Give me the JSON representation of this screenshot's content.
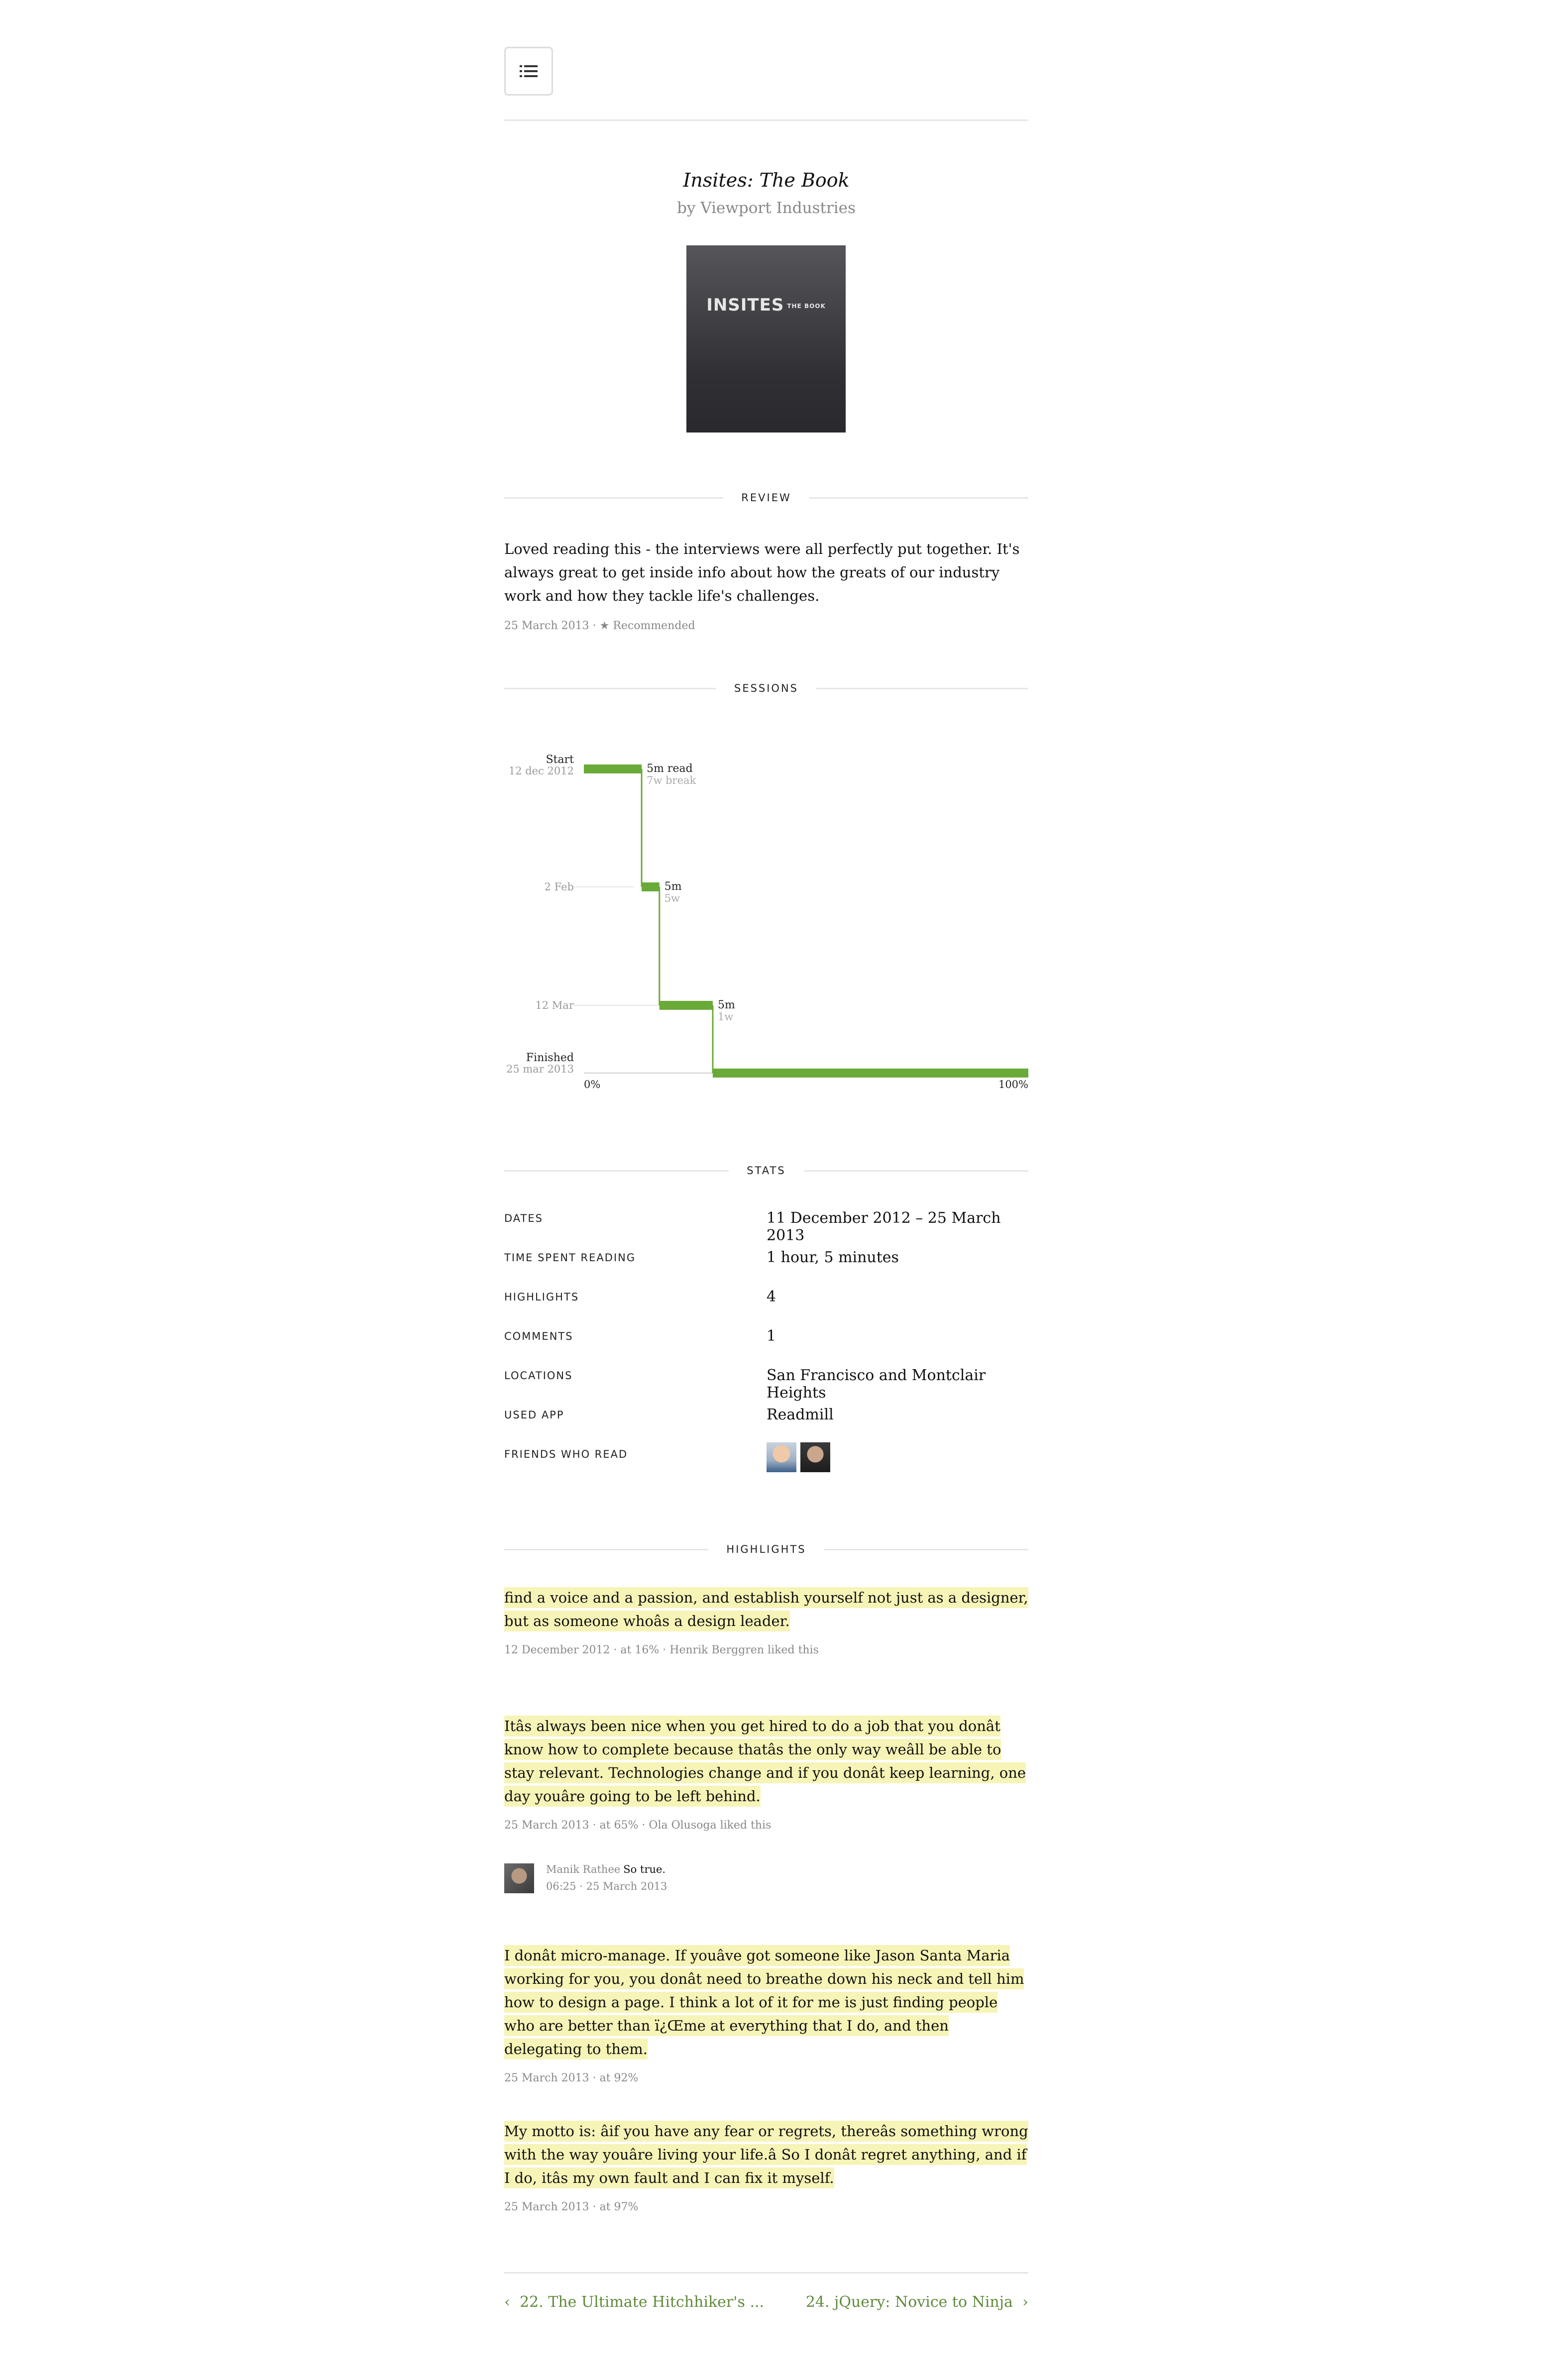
{
  "header": {
    "menu_icon": "list-icon"
  },
  "book": {
    "title": "Insites: The Book",
    "author": "by Viewport Industries",
    "cover_text": "INSITES",
    "cover_sub": "THE BOOK"
  },
  "review": {
    "heading": "REVIEW",
    "text": "Loved reading this - the interviews were all perfectly put together. It's always great to get inside info about how the greats of our industry work and how they tackle life's challenges.",
    "meta": "25 March 2013 · ★ Recommended"
  },
  "sessions": {
    "heading": "SESSIONS",
    "labels": {
      "start_title": "Start",
      "start_date": "12 dec 2012",
      "feb": "2 Feb",
      "mar": "12 Mar",
      "finished_title": "Finished",
      "finished_date": "25 mar 2013",
      "x_min": "0%",
      "x_max": "100%"
    },
    "accent_color": "#6aaa38"
  },
  "chart_data": {
    "type": "bar",
    "title": "",
    "xlabel": "",
    "ylabel": "",
    "x_range": [
      "0%",
      "100%"
    ],
    "sessions": [
      {
        "date": "12 dec 2012",
        "from_pct": 0,
        "to_pct": 13,
        "duration": "5m read",
        "break": "7w break"
      },
      {
        "date": "2 Feb",
        "from_pct": 13,
        "to_pct": 17,
        "duration": "5m",
        "break": "5w"
      },
      {
        "date": "12 Mar",
        "from_pct": 17,
        "to_pct": 29,
        "duration": "5m",
        "break": "1w"
      },
      {
        "date": "25 mar 2013",
        "from_pct": 29,
        "to_pct": 100,
        "duration": "",
        "break": ""
      }
    ]
  },
  "stats": {
    "heading": "STATS",
    "rows": [
      {
        "label": "DATES",
        "value": "11 December 2012 – 25 March 2013"
      },
      {
        "label": "TIME SPENT READING",
        "value": "1 hour, 5 minutes"
      },
      {
        "label": "HIGHLIGHTS",
        "value": "4"
      },
      {
        "label": "COMMENTS",
        "value": "1"
      },
      {
        "label": "LOCATIONS",
        "value": "San Francisco and Montclair Heights"
      },
      {
        "label": "USED APP",
        "value": "Readmill"
      },
      {
        "label": "FRIENDS WHO READ",
        "value": ""
      }
    ]
  },
  "highlights": {
    "heading": "HIGHLIGHTS",
    "items": [
      {
        "text": "find a voice and a passion, and establish yourself not just as a designer, but as someone whoâs a design leader.",
        "meta": "12 December 2012 · at 16% · Henrik Berggren liked this"
      },
      {
        "text": "Itâs always been nice when you get hired to do a job that you donât know how to complete because thatâs the only way weâll be able to stay relevant. Technologies change and if you donât keep learning, one day youâre going to be left behind.",
        "meta": "25 March 2013 · at 65% · Ola Olusoga liked this"
      },
      {
        "text": "I donât micro-manage. If youâve got someone like Jason Santa Maria working for you, you donât need to breathe down his neck and tell him how to design a page. I think a lot of it for me is just finding people who are better than ï¿Œme at everything that I do, and then delegating to them.",
        "meta": "25 March 2013 · at 92%"
      },
      {
        "text": "My motto is: âif you have any fear or regrets, thereâs something wrong with the way youâre living your life.â So I donât regret anything, and if I do, itâs my own fault and I can fix it myself.",
        "meta": "25 March 2013 · at 97%"
      }
    ],
    "comment": {
      "name": "Manik Rathee",
      "text": "So true.",
      "time": "06:25 · 25 March 2013"
    }
  },
  "nav": {
    "prev": "22. The Ultimate Hitchhiker's ...",
    "next": "24. jQuery: Novice to Ninja"
  }
}
